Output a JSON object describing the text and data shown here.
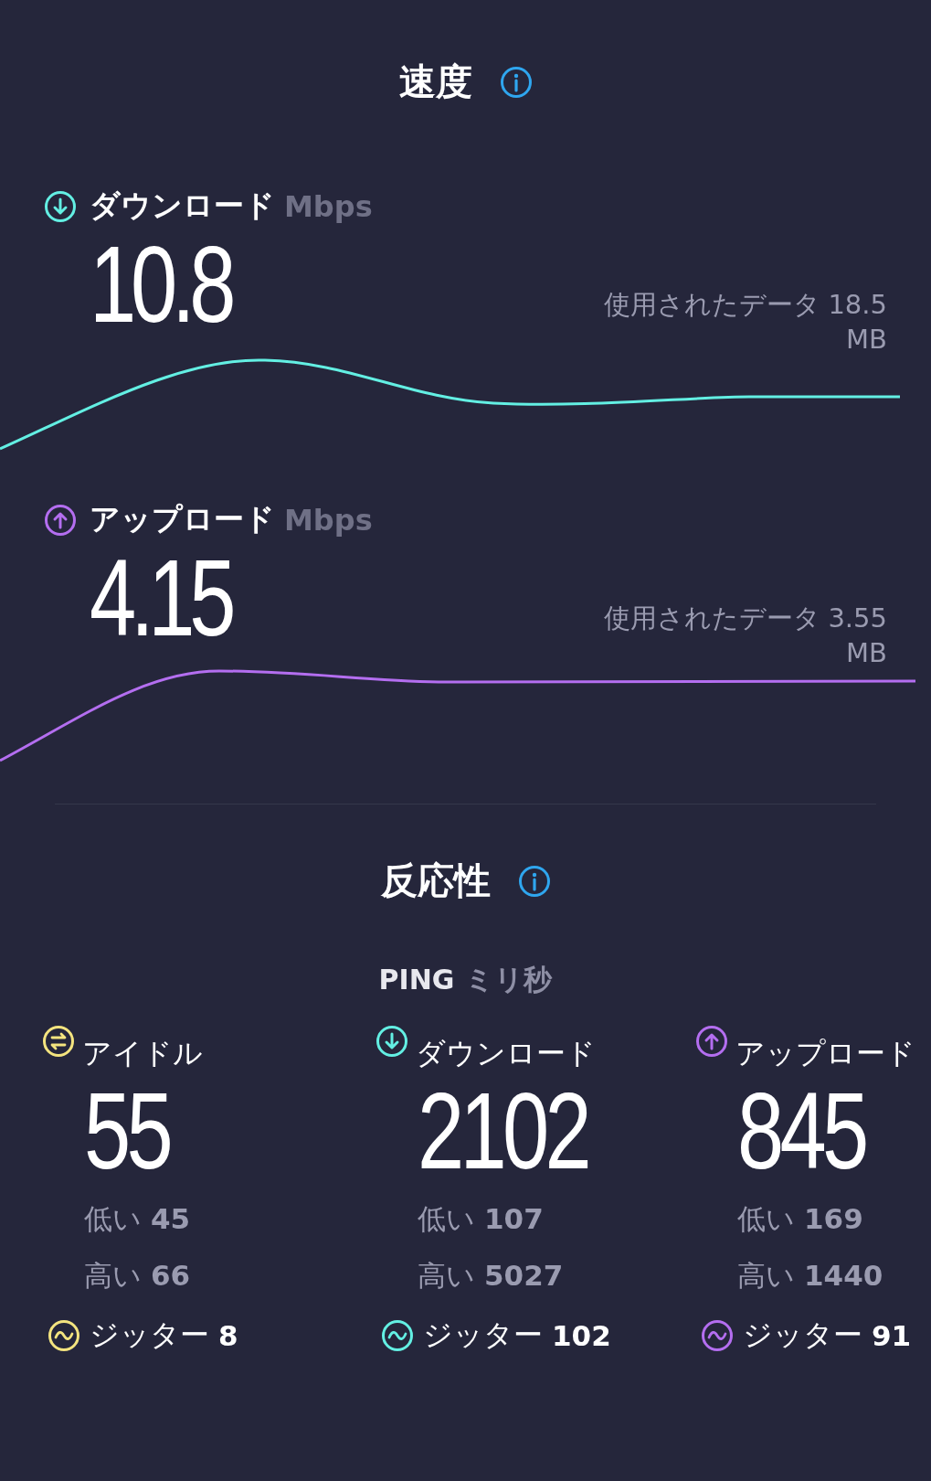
{
  "speed": {
    "title": "速度",
    "tests": [
      {
        "kind": "download",
        "label": "ダウンロード",
        "unit": "Mbps",
        "value": "10.8",
        "data_label": "使用されたデータ",
        "data_value": "18.5",
        "data_unit": "MB"
      },
      {
        "kind": "upload",
        "label": "アップロード",
        "unit": "Mbps",
        "value": "4.15",
        "data_label": "使用されたデータ",
        "data_value": "3.55",
        "data_unit": "MB"
      }
    ]
  },
  "responsiveness": {
    "title": "反応性",
    "ping_label": "PING",
    "ping_unit": "ミリ秒",
    "columns": [
      {
        "kind": "idle",
        "label": "アイドル",
        "value": "55",
        "low_label": "低い",
        "low": "45",
        "high_label": "高い",
        "high": "66",
        "jitter_label": "ジッター",
        "jitter": "8"
      },
      {
        "kind": "download",
        "label": "ダウンロード",
        "value": "2102",
        "low_label": "低い",
        "low": "107",
        "high_label": "高い",
        "high": "5027",
        "jitter_label": "ジッター",
        "jitter": "102"
      },
      {
        "kind": "upload",
        "label": "アップロード",
        "value": "845",
        "low_label": "低い",
        "low": "169",
        "high_label": "高い",
        "high": "1440",
        "jitter_label": "ジッター",
        "jitter": "91"
      }
    ]
  }
}
